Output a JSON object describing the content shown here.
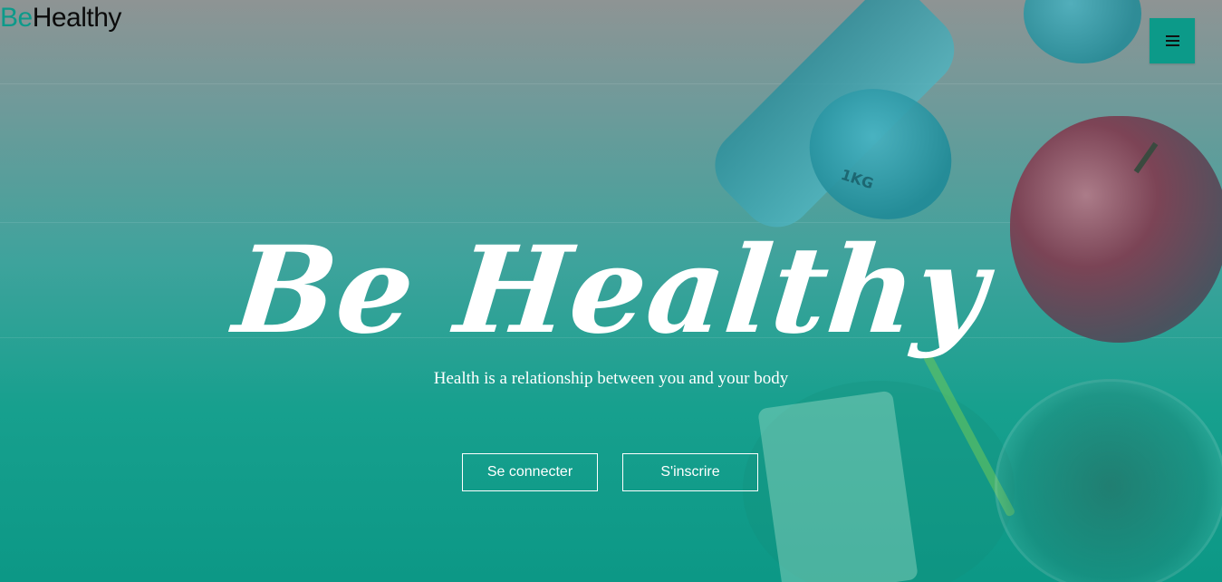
{
  "brand": {
    "logo_part1": "Be",
    "logo_part2": "Healthy"
  },
  "nav": {
    "menu_icon": "hamburger-menu-icon"
  },
  "hero": {
    "title": "Be Healthy",
    "tagline": "Health is a relationship between you and your body",
    "image_text": "1KG"
  },
  "actions": {
    "login_label": "Se connecter",
    "signup_label": "S'inscrire"
  },
  "colors": {
    "accent": "#0c9a89",
    "overlay_top": "#8e9494",
    "overlay_bottom": "#0c9886",
    "text": "#ffffff"
  }
}
